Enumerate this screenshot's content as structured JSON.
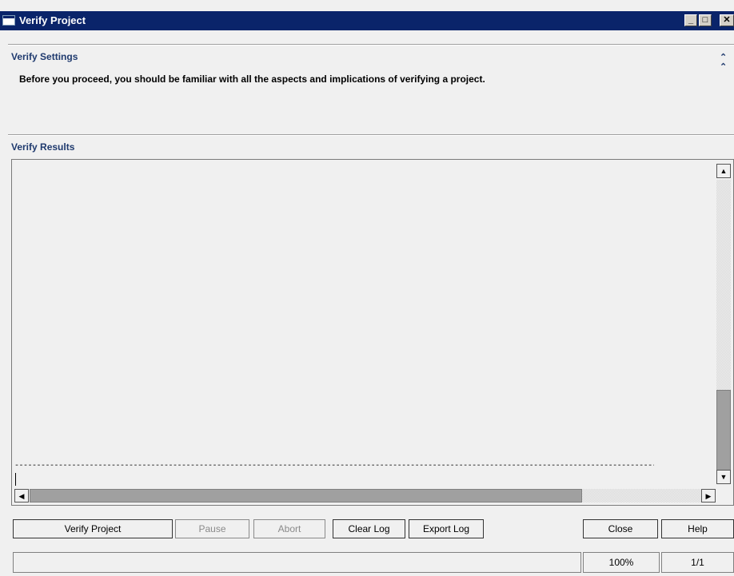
{
  "window": {
    "title": "Verify Project",
    "controls": {
      "minimize": "_",
      "maximize": "□",
      "close": "✕"
    }
  },
  "settings": {
    "title": "Verify Settings",
    "description": "Before you proceed, you should be familiar with all the aspects and implications of verifying a project.",
    "collapse_icon": "double-chevron-up"
  },
  "results": {
    "title": "Verify Results",
    "log_separator": "----------------------------------------------------------------------------------------------------------------------------------------------------------------------------------"
  },
  "buttons": {
    "verify_project": "Verify Project",
    "pause": "Pause",
    "abort": "Abort",
    "clear_log": "Clear Log",
    "export_log": "Export Log",
    "close": "Close",
    "help": "Help"
  },
  "status": {
    "message": "",
    "zoom": "100%",
    "page": "1/1"
  }
}
